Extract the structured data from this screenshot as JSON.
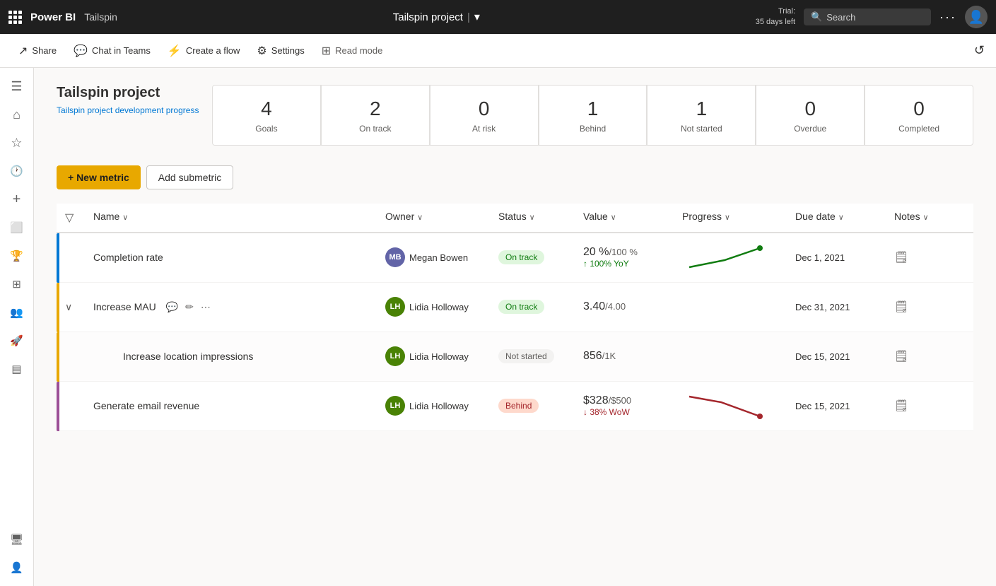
{
  "app": {
    "brand": "Power BI",
    "app_name": "Tailspin",
    "project_title": "Tailspin project",
    "trial_line1": "Trial:",
    "trial_line2": "35 days left",
    "search_placeholder": "Search"
  },
  "toolbar": {
    "share_label": "Share",
    "chat_label": "Chat in Teams",
    "flow_label": "Create a flow",
    "settings_label": "Settings",
    "read_mode_label": "Read mode"
  },
  "header": {
    "project_name": "Tailspin project",
    "subtitle": "Tailspin project development progress"
  },
  "stats": [
    {
      "num": "4",
      "label": "Goals"
    },
    {
      "num": "2",
      "label": "On track"
    },
    {
      "num": "0",
      "label": "At risk"
    },
    {
      "num": "1",
      "label": "Behind"
    },
    {
      "num": "1",
      "label": "Not started"
    },
    {
      "num": "0",
      "label": "Overdue"
    },
    {
      "num": "0",
      "label": "Completed"
    }
  ],
  "actions": {
    "new_metric": "+ New metric",
    "add_submetric": "Add submetric"
  },
  "table": {
    "columns": [
      "",
      "Name",
      "Owner",
      "Status",
      "Value",
      "Progress",
      "Due date",
      "Notes"
    ],
    "rows": [
      {
        "id": "completion-rate",
        "indent": false,
        "indicator_color": "#0078d4",
        "name": "Completion rate",
        "owner_initials": "MB",
        "owner_name": "Megan Bowen",
        "owner_class": "owner-mb",
        "status": "On track",
        "status_class": "status-on-track",
        "value": "20 %",
        "value_unit": "/100 %",
        "value_note": "↑ 100% YoY",
        "value_note_class": "yoy",
        "due_date": "Dec 1, 2021",
        "has_chart": true,
        "chart_type": "up"
      },
      {
        "id": "increase-mau",
        "indent": false,
        "indicator_color": "#e8a800",
        "name": "Increase MAU",
        "owner_initials": "LH",
        "owner_name": "Lidia Holloway",
        "owner_class": "owner-lh",
        "status": "On track",
        "status_class": "status-on-track",
        "value": "3.40",
        "value_unit": "/4.00",
        "value_note": "",
        "due_date": "Dec 31, 2021",
        "has_chart": false,
        "expandable": true
      },
      {
        "id": "increase-location",
        "indent": true,
        "indicator_color": "#e8a800",
        "name": "Increase location impressions",
        "owner_initials": "LH",
        "owner_name": "Lidia Holloway",
        "owner_class": "owner-lh",
        "status": "Not started",
        "status_class": "status-not-started",
        "value": "856",
        "value_unit": "/1K",
        "value_note": "",
        "due_date": "Dec 15, 2021",
        "has_chart": false
      },
      {
        "id": "generate-email",
        "indent": false,
        "indicator_color": "#9b4f96",
        "name": "Generate email revenue",
        "owner_initials": "LH",
        "owner_name": "Lidia Holloway",
        "owner_class": "owner-lh",
        "status": "Behind",
        "status_class": "status-behind",
        "value": "$328",
        "value_unit": "/$500",
        "value_note": "↓ 38% WoW",
        "value_note_class": "wow",
        "due_date": "Dec 15, 2021",
        "has_chart": true,
        "chart_type": "down"
      }
    ]
  },
  "sidebar": {
    "items": [
      {
        "icon": "☰",
        "name": "menu",
        "label": "Menu"
      },
      {
        "icon": "⌂",
        "name": "home",
        "label": "Home"
      },
      {
        "icon": "★",
        "name": "favorites",
        "label": "Favorites"
      },
      {
        "icon": "🕐",
        "name": "recent",
        "label": "Recent"
      },
      {
        "icon": "+",
        "name": "create",
        "label": "Create"
      },
      {
        "icon": "□",
        "name": "apps",
        "label": "Apps"
      },
      {
        "icon": "🏆",
        "name": "goals",
        "label": "Goals"
      },
      {
        "icon": "⊞",
        "name": "dashboards",
        "label": "Dashboards"
      },
      {
        "icon": "👥",
        "name": "people",
        "label": "People"
      },
      {
        "icon": "🚀",
        "name": "deploy",
        "label": "Deploy"
      },
      {
        "icon": "≡",
        "name": "reports",
        "label": "Reports"
      },
      {
        "icon": "🖥",
        "name": "monitor",
        "label": "Monitor"
      },
      {
        "icon": "👤",
        "name": "admin",
        "label": "Admin"
      }
    ]
  }
}
